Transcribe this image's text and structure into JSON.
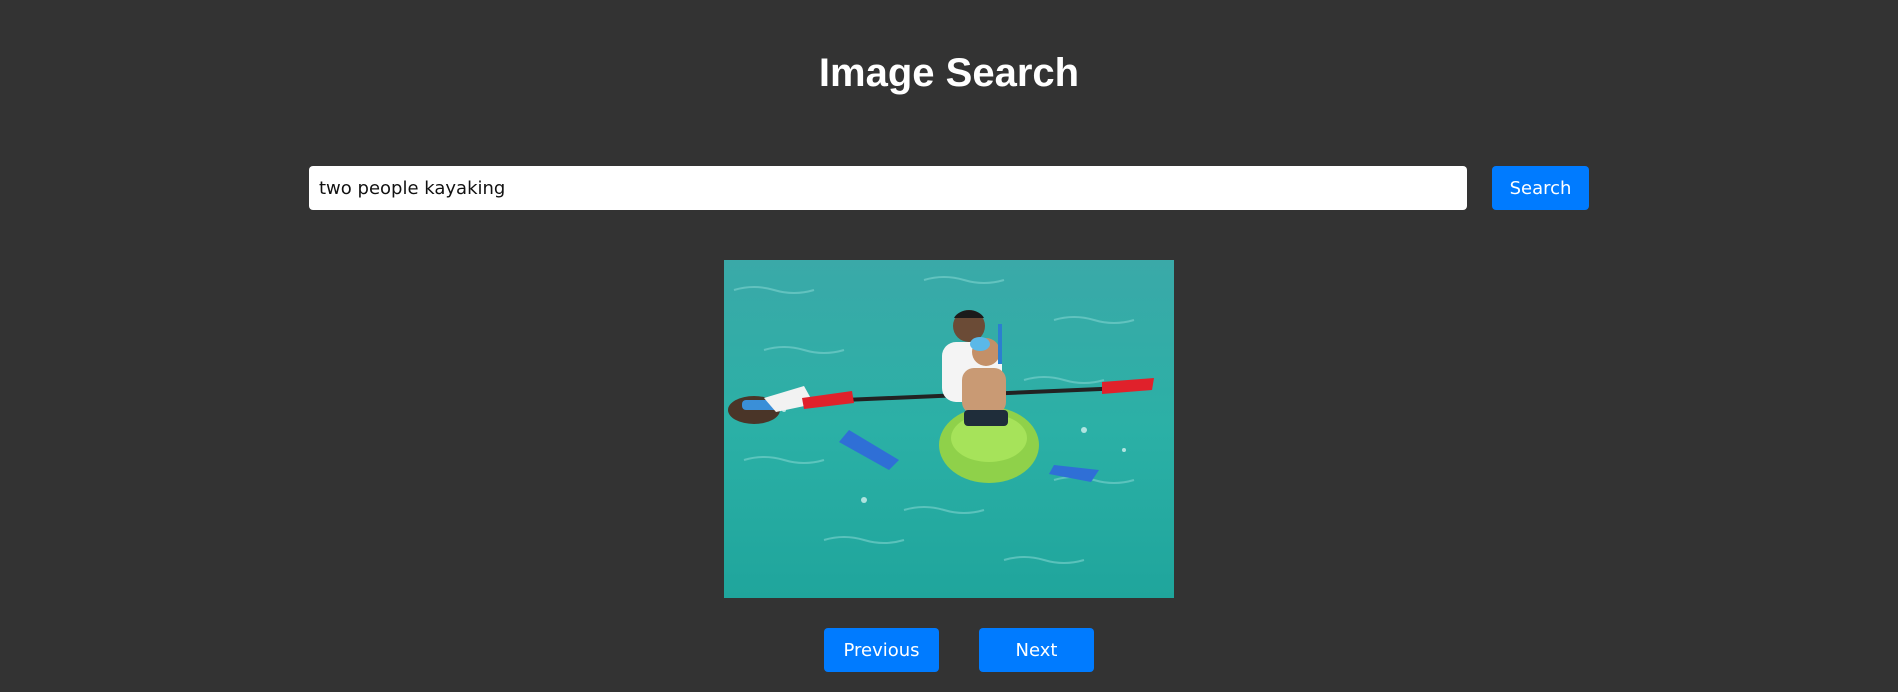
{
  "header": {
    "title": "Image Search"
  },
  "search": {
    "query": "two people kayaking",
    "button_label": "Search"
  },
  "result": {
    "image_description_icon": "photo-icon"
  },
  "pagination": {
    "previous_label": "Previous",
    "next_label": "Next"
  },
  "colors": {
    "background": "#333333",
    "accent": "#007bff",
    "text": "#ffffff"
  }
}
